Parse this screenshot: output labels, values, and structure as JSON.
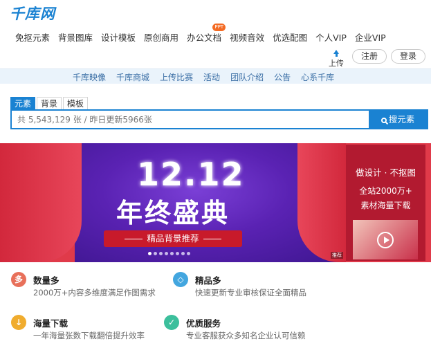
{
  "logo": "千库网",
  "nav": [
    "免抠元素",
    "背景图库",
    "设计模板",
    "原创商用",
    "办公文档",
    "视频音效",
    "优选配图",
    "个人VIP",
    "企业VIP"
  ],
  "ppt_badge": "PPT",
  "header": {
    "upload": "上传",
    "register": "注册",
    "login": "登录"
  },
  "subnav": [
    "千库映像",
    "千库商城",
    "上传比赛",
    "活动",
    "团队介绍",
    "公告",
    "心系千库"
  ],
  "search": {
    "tabs": [
      "元素",
      "背景",
      "模板"
    ],
    "placeholder": "共 5,543,129 张 / 昨日更新5966张",
    "button": "搜元素"
  },
  "banner": {
    "headline": "12.12",
    "title": "年终盛典",
    "ribbon": "精品背景推荐",
    "ad_label": "推荐",
    "slide_count": 8,
    "active_slide": 1
  },
  "side_ad": {
    "title": "做设计 · 不抠图",
    "line1": "全站2000万+",
    "line2": "素材海量下载"
  },
  "features": [
    {
      "title": "数量多",
      "desc": "2000万+内容多维度满足作图需求",
      "icon": "多",
      "color": "#e8705a"
    },
    {
      "title": "精品多",
      "desc": "快速更新专业审核保证全面精品",
      "icon": "◇",
      "color": "#43a6df"
    },
    {
      "title": "海量下载",
      "desc": "一年海量张数下载翻倍提升效率",
      "icon": "↓",
      "color": "#f0ac2e"
    },
    {
      "title": "优质服务",
      "desc": "专业客服获众多知名企业认可信赖",
      "icon": "✓",
      "color": "#3cbf9c"
    }
  ]
}
